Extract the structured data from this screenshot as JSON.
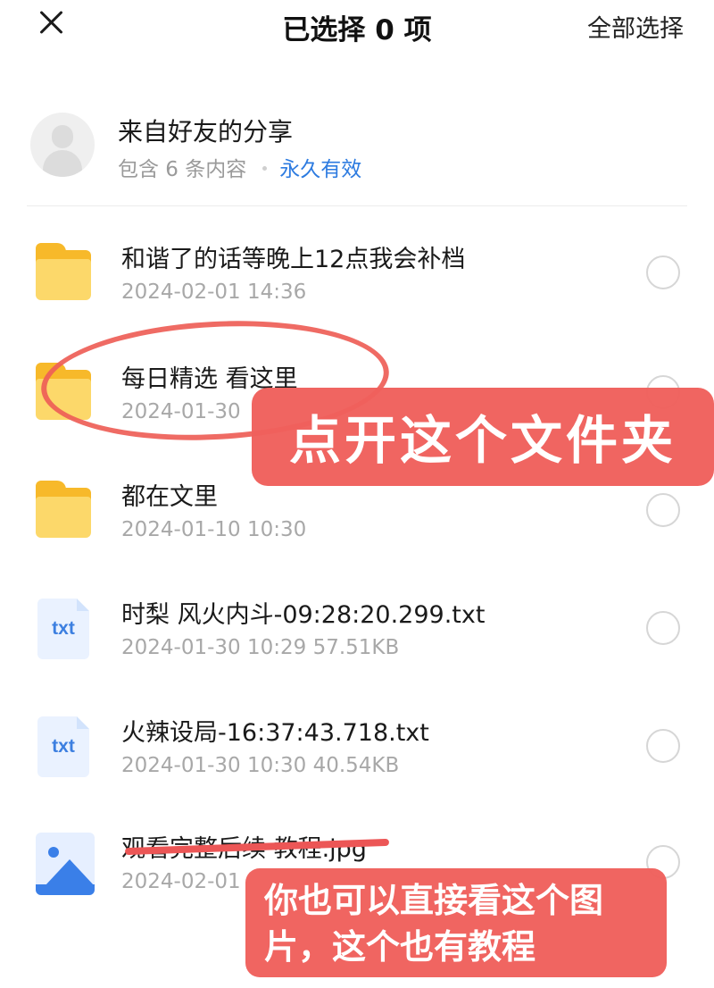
{
  "topbar": {
    "title": "已选择 0 项",
    "select_all": "全部选择"
  },
  "share": {
    "title": "来自好友的分享",
    "count": "包含 6 条内容",
    "validity": "永久有效"
  },
  "files": [
    {
      "name": "和谐了的话等晚上12点我会补档",
      "meta": "2024-02-01 14:36",
      "type": "folder",
      "icon": "folder-icon"
    },
    {
      "name": "每日精选 看这里",
      "meta": "2024-01-30",
      "type": "folder",
      "icon": "folder-icon"
    },
    {
      "name": "都在文里",
      "meta": "2024-01-10 10:30",
      "type": "folder",
      "icon": "folder-icon"
    },
    {
      "name": "时梨 风火内斗-09:28:20.299.txt",
      "meta": "2024-01-30 10:29 57.51KB",
      "type": "txt",
      "icon": "txt-file-icon",
      "icon_label": "txt"
    },
    {
      "name": "火辣设局-16:37:43.718.txt",
      "meta": "2024-01-30 10:30 40.54KB",
      "type": "txt",
      "icon": "txt-file-icon",
      "icon_label": "txt"
    },
    {
      "name": "观看完整后续 教程.jpg",
      "meta": "2024-02-01",
      "type": "image",
      "icon": "image-file-icon"
    }
  ],
  "annotations": {
    "callout_folder": "点开这个文件夹",
    "callout_image": "你也可以直接看这个图片，这个也有教程"
  },
  "colors": {
    "accent_blue": "#2d7be0",
    "annotation_red": "#ef605c",
    "folder_yellow": "#fcd86a"
  }
}
